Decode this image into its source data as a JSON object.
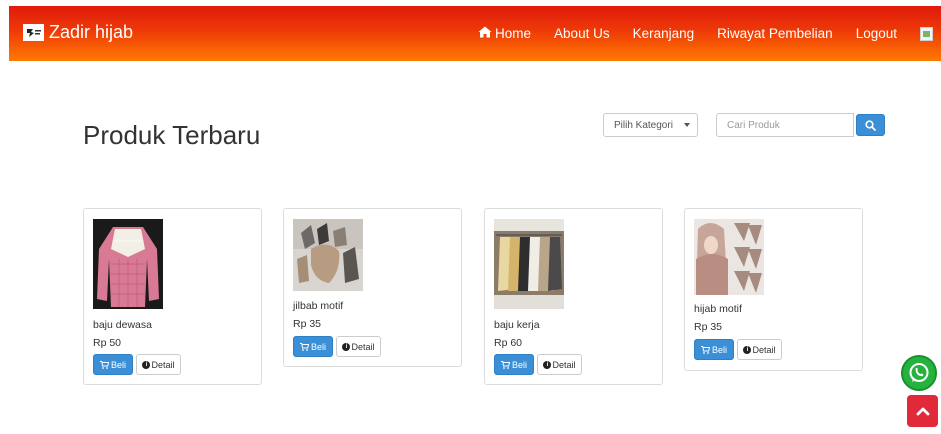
{
  "navbar": {
    "brand": "Zadir hijab",
    "links": [
      "Home",
      "About Us",
      "Keranjang",
      "Riwayat Pembelian",
      "Logout"
    ]
  },
  "main": {
    "title": "Produk Terbaru",
    "category_select": "Pilih Kategori",
    "search_placeholder": "Cari Produk"
  },
  "products": [
    {
      "name": "baju dewasa",
      "price": "Rp 50",
      "buy": "Beli",
      "detail": "Detail"
    },
    {
      "name": "jilbab motif",
      "price": "Rp 35",
      "buy": "Beli",
      "detail": "Detail"
    },
    {
      "name": "baju kerja",
      "price": "Rp 60",
      "buy": "Beli",
      "detail": "Detail"
    },
    {
      "name": "hijab motif",
      "price": "Rp 35",
      "buy": "Beli",
      "detail": "Detail"
    }
  ],
  "colors": {
    "navbar_top": "#e01a0c",
    "navbar_bottom": "#ff7a00",
    "primary_button": "#3a8fd6",
    "whatsapp": "#25b33e",
    "scroll_top": "#e02a3a"
  }
}
